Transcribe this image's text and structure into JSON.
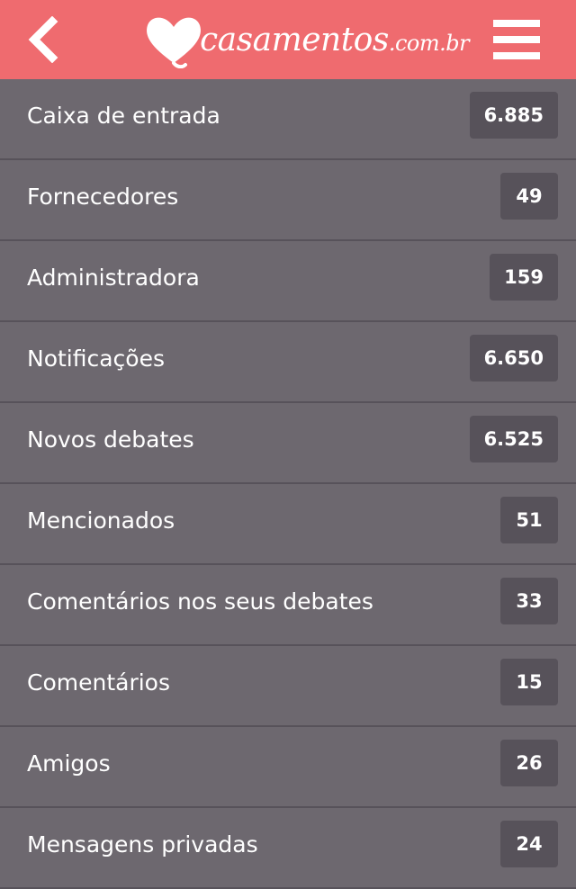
{
  "header": {
    "back_icon": "chevron-left-icon",
    "menu_icon": "hamburger-menu-icon",
    "logo": {
      "name": "casamentos",
      "domain": ".com.br"
    },
    "colors": {
      "header_bg": "#ef6b6f",
      "list_bg": "#6d686f",
      "badge_bg": "#57525a",
      "text": "#ffffff"
    }
  },
  "items": [
    {
      "label": "Caixa de entrada",
      "count": "6.885"
    },
    {
      "label": "Fornecedores",
      "count": "49"
    },
    {
      "label": "Administradora",
      "count": "159"
    },
    {
      "label": "Notificações",
      "count": "6.650"
    },
    {
      "label": "Novos debates",
      "count": "6.525"
    },
    {
      "label": "Mencionados",
      "count": "51"
    },
    {
      "label": "Comentários nos seus debates",
      "count": "33"
    },
    {
      "label": "Comentários",
      "count": "15"
    },
    {
      "label": "Amigos",
      "count": "26"
    },
    {
      "label": "Mensagens privadas",
      "count": "24"
    }
  ]
}
